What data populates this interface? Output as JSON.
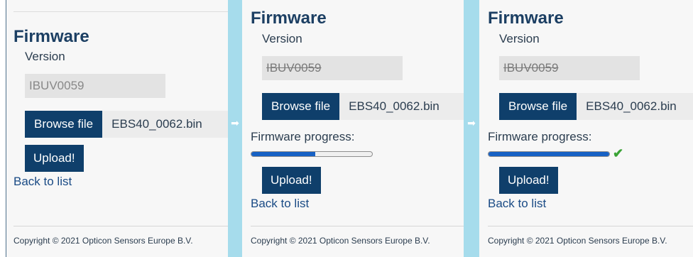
{
  "panels": [
    {
      "title": "Firmware",
      "version_label": "Version",
      "version_value": "IBUV0059",
      "browse_label": "Browse file",
      "file_name": "EBS40_0062.bin",
      "upload_label": "Upload!",
      "back_label": "Back to list",
      "copyright": "Copyright © 2021 Opticon Sensors Europe B.V."
    },
    {
      "title": "Firmware",
      "version_label": "Version",
      "version_value": "IBUV0059",
      "browse_label": "Browse file",
      "file_name": "EBS40_0062.bin",
      "progress_label": "Firmware progress:",
      "progress_value": 0.53,
      "upload_label": "Upload!",
      "back_label": "Back to list",
      "copyright": "Copyright © 2021 Opticon Sensors Europe B.V."
    },
    {
      "title": "Firmware",
      "version_label": "Version",
      "version_value": "IBUV0059",
      "browse_label": "Browse file",
      "file_name": "EBS40_0062.bin",
      "progress_label": "Firmware progress:",
      "progress_value": 1.0,
      "progress_status_icon": "check-icon",
      "upload_label": "Upload!",
      "back_label": "Back to list",
      "copyright": "Copyright © 2021 Opticon Sensors Europe B.V."
    }
  ],
  "colors": {
    "primary_button": "#0f3f6b",
    "title": "#1c3f63",
    "progress_fill": "#1761c4",
    "separator": "#a6dcec",
    "success": "#3aa335"
  },
  "separator_icon": "arrow-right-icon"
}
